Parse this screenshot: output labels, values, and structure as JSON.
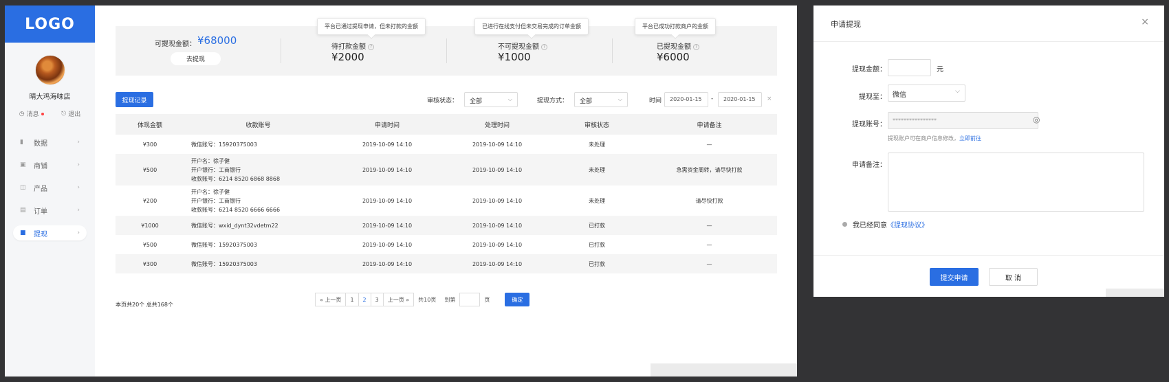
{
  "sidebar": {
    "logo": "LOGO",
    "shop_name": "晴大鸡海味店",
    "messages_label": "消息",
    "logout_label": "退出",
    "nav": [
      {
        "label": "数据",
        "icon": "bar-chart-icon"
      },
      {
        "label": "商铺",
        "icon": "store-icon"
      },
      {
        "label": "产品",
        "icon": "product-icon"
      },
      {
        "label": "订单",
        "icon": "order-icon"
      },
      {
        "label": "提现",
        "icon": "wallet-icon",
        "active": true
      }
    ]
  },
  "summary": {
    "available_label": "可提现金额：",
    "available_value": "¥68000",
    "withdraw_button": "去提现",
    "pending": {
      "label": "待打款金额",
      "value": "¥2000",
      "tip": "平台已通过提现申请，但未打款的金额"
    },
    "unavailable": {
      "label": "不可提现金额",
      "value": "¥1000",
      "tip": "已进行在线支付但未交易完成的订单金额"
    },
    "withdrawn": {
      "label": "已提现金额",
      "value": "¥6000",
      "tip": "平台已成功打款商户的金额"
    }
  },
  "filters": {
    "records_button": "提现记录",
    "status_label": "审核状态：",
    "status_value": "全部",
    "method_label": "提现方式：",
    "method_value": "全部",
    "time_label": "时间",
    "date_from": "2020-01-15",
    "date_sep": "-",
    "date_to": "2020-01-15",
    "clear": "×"
  },
  "table": {
    "headers": [
      "体现金额",
      "收款账号",
      "申请时间",
      "处理时间",
      "审核状态",
      "申请备注"
    ],
    "rows": [
      {
        "amount": "¥300",
        "account": [
          "微信账号：15920375003"
        ],
        "apply_time": "2019-10-09 14:10",
        "process_time": "2019-10-09 14:10",
        "status": "未处理",
        "remark": "—"
      },
      {
        "amount": "¥500",
        "account": [
          "开户名：徐子健",
          "开户银行：工商银行",
          "收款账号：6214 8520 6868 8868"
        ],
        "apply_time": "2019-10-09 14:10",
        "process_time": "2019-10-09 14:10",
        "status": "未处理",
        "remark": "急需资金周转，请尽快打款"
      },
      {
        "amount": "¥200",
        "account": [
          "开户名：徐子健",
          "开户银行：工商银行",
          "收款账号：6214 8520 6666 6666"
        ],
        "apply_time": "2019-10-09 14:10",
        "process_time": "2019-10-09 14:10",
        "status": "未处理",
        "remark": "请尽快打款"
      },
      {
        "amount": "¥1000",
        "account": [
          "微信账号：wxid_dynt32vdetm22"
        ],
        "apply_time": "2019-10-09 14:10",
        "process_time": "2019-10-09 14:10",
        "status": "已打款",
        "remark": "—"
      },
      {
        "amount": "¥500",
        "account": [
          "微信账号：15920375003"
        ],
        "apply_time": "2019-10-09 14:10",
        "process_time": "2019-10-09 14:10",
        "status": "已打款",
        "remark": "—"
      },
      {
        "amount": "¥300",
        "account": [
          "微信账号：15920375003"
        ],
        "apply_time": "2019-10-09 14:10",
        "process_time": "2019-10-09 14:10",
        "status": "已打款",
        "remark": "—"
      }
    ]
  },
  "pagination": {
    "info": "本页共20个  总共168个",
    "first": "« 上一页",
    "pages": [
      "1",
      "2",
      "3"
    ],
    "current": "2",
    "next": "上一页 »",
    "total_pages": "共10页",
    "goto_label": "到第",
    "page_unit": "页",
    "confirm": "确定"
  },
  "dialog": {
    "title": "申请提现",
    "close": "×",
    "amount_label": "提现金额：",
    "amount_value": "",
    "amount_unit": "元",
    "to_label": "提现至：",
    "to_value": "微信",
    "account_label": "提现账号：",
    "account_value": "****************",
    "account_hint": "提现账户可在商户信息修改，",
    "account_hint_link": "立即前往",
    "remark_label": "申请备注：",
    "remark_value": "",
    "agree_text": "我已经同意",
    "agree_link": "《提现协议》",
    "submit": "提交申请",
    "cancel": "取 消"
  },
  "colors": {
    "accent": "#2a6ee2",
    "background": "#333335"
  }
}
